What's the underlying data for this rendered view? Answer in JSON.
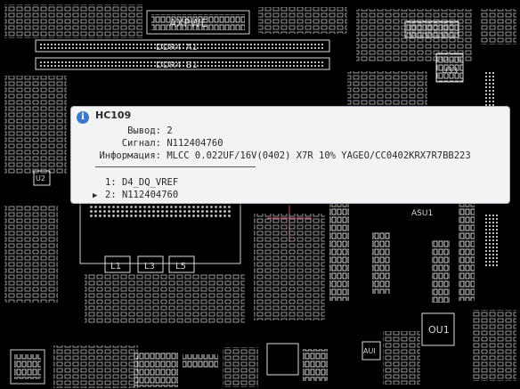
{
  "board": {
    "labels": {
      "apxwe": "AXPWE",
      "ddr_a1": "DDR4_A1",
      "ddr_b1": "DDR4_B1",
      "u33": "U33",
      "u2": "U2",
      "asu1": "ASU1",
      "ou1": "OU1",
      "l1": "L1",
      "l3": "L3",
      "l5": "L5",
      "aui": "AUI"
    }
  },
  "tooltip": {
    "component": "HC109",
    "fields": [
      {
        "label": "Вывод:",
        "value": "2"
      },
      {
        "label": "Сигнал:",
        "value": "N112404760"
      },
      {
        "label": "Информация:",
        "value": "MLCC 0.022UF/16V(0402) X7R 10% YAGEO/CC0402KRX7R7BB223"
      }
    ],
    "nets": [
      {
        "text": "1: D4_DQ_VREF",
        "marker": ""
      },
      {
        "text": "2: N112404760",
        "marker": "▶"
      }
    ]
  }
}
